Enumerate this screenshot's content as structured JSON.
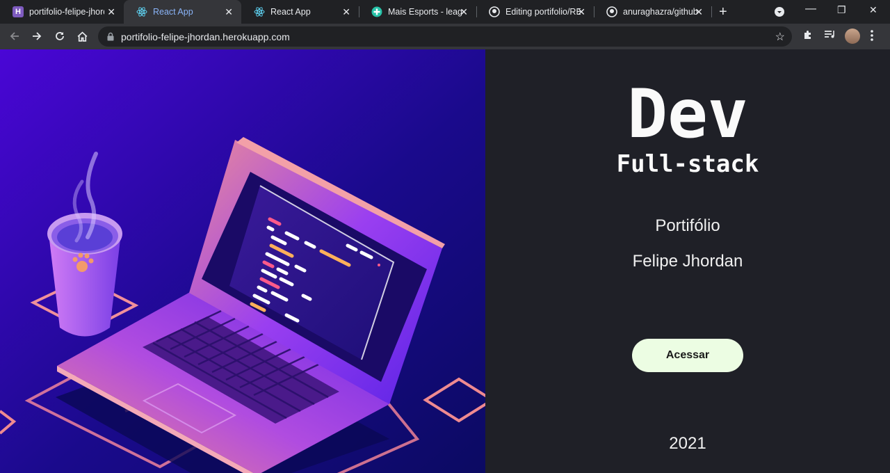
{
  "browser": {
    "tabs": [
      {
        "title": "portifolio-felipe-jhordan",
        "icon": "heroku-icon",
        "active": false
      },
      {
        "title": "React App",
        "icon": "react-icon",
        "active": true
      },
      {
        "title": "React App",
        "icon": "react-icon",
        "active": false
      },
      {
        "title": "Mais Esports - league",
        "icon": "plus-icon",
        "active": false
      },
      {
        "title": "Editing portifolio/README",
        "icon": "github-icon",
        "active": false
      },
      {
        "title": "anuraghazra/github-readme",
        "icon": "github-icon",
        "active": false
      }
    ],
    "url": "portifolio-felipe-jhordan.herokuapp.com",
    "accent": "#8ab4f8"
  },
  "page": {
    "title": "Dev",
    "subtitle": "Full-stack",
    "portfolio_label": "Portifólio",
    "author": "Felipe Jhordan",
    "cta_label": "Acessar",
    "year": "2021",
    "background": "#1f2027",
    "button_color": "#ecfde3"
  }
}
